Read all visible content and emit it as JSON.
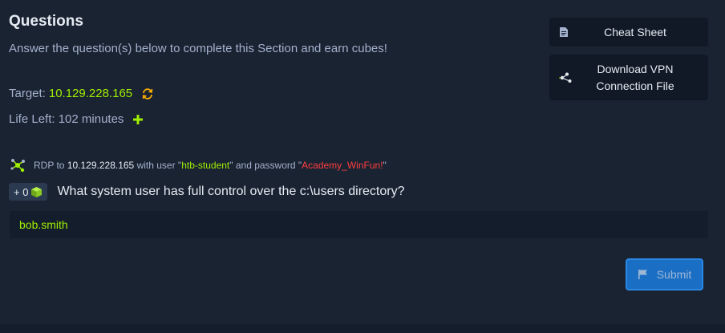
{
  "section": {
    "title": "Questions",
    "subtitle": "Answer the question(s) below to complete this Section and earn cubes!"
  },
  "target": {
    "label": "Target:",
    "ip": "10.129.228.165"
  },
  "life": {
    "text": "Life Left: 102 minutes"
  },
  "sidebar": {
    "cheat_sheet": "Cheat Sheet",
    "vpn_line1": "Download VPN",
    "vpn_line2": "Connection File"
  },
  "rdp": {
    "prefix": "RDP to",
    "ip": "10.129.228.165",
    "with_user": "with user \"",
    "user": "htb-student",
    "and_password": "\" and password \"",
    "password": "Academy_WinFun!",
    "suffix": "\""
  },
  "question": {
    "cubes": "+ 0",
    "text": "What system user has full control over the c:\\users directory?",
    "answer_value": "bob.smith"
  },
  "submit": {
    "label": "Submit"
  },
  "colors": {
    "background": "#1a2332",
    "accent_green": "#9fef00",
    "password_red": "#ff3e3e",
    "submit_blue": "#1a6ec4"
  }
}
